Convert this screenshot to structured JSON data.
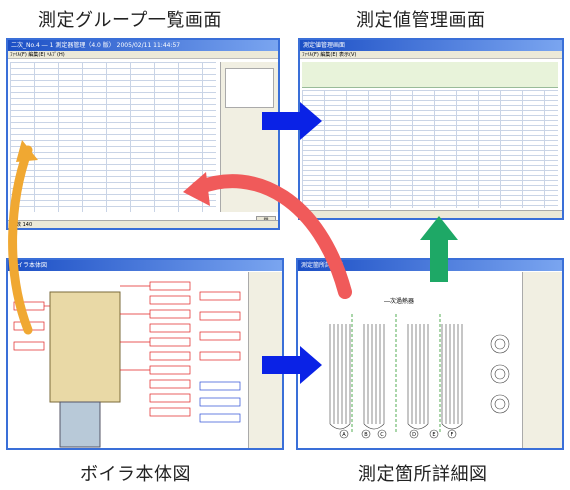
{
  "captions": {
    "group_list": "測定グループ一覧画面",
    "value_mgmt": "測定値管理画面",
    "boiler": "ボイラ本体図",
    "detail": "測定箇所詳細図"
  },
  "windows": {
    "group_list_title": "二次_No.4 ― 1 測定器管理（4.0 版）   2005/02/11 11:44:57",
    "value_mgmt_title": "測定値管理画面",
    "boiler_title": "ボイラ本体図",
    "detail_title": "測定箇所詳細図",
    "detail_heading": "―次過熱器"
  },
  "detail_labels": [
    "A",
    "B",
    "C",
    "D",
    "E",
    "F"
  ],
  "colors": {
    "blue_arrow": "#0a22e6",
    "green_arrow": "#1ea866",
    "red_arrow": "#f05a5a",
    "window_border": "#3a6fd8"
  }
}
